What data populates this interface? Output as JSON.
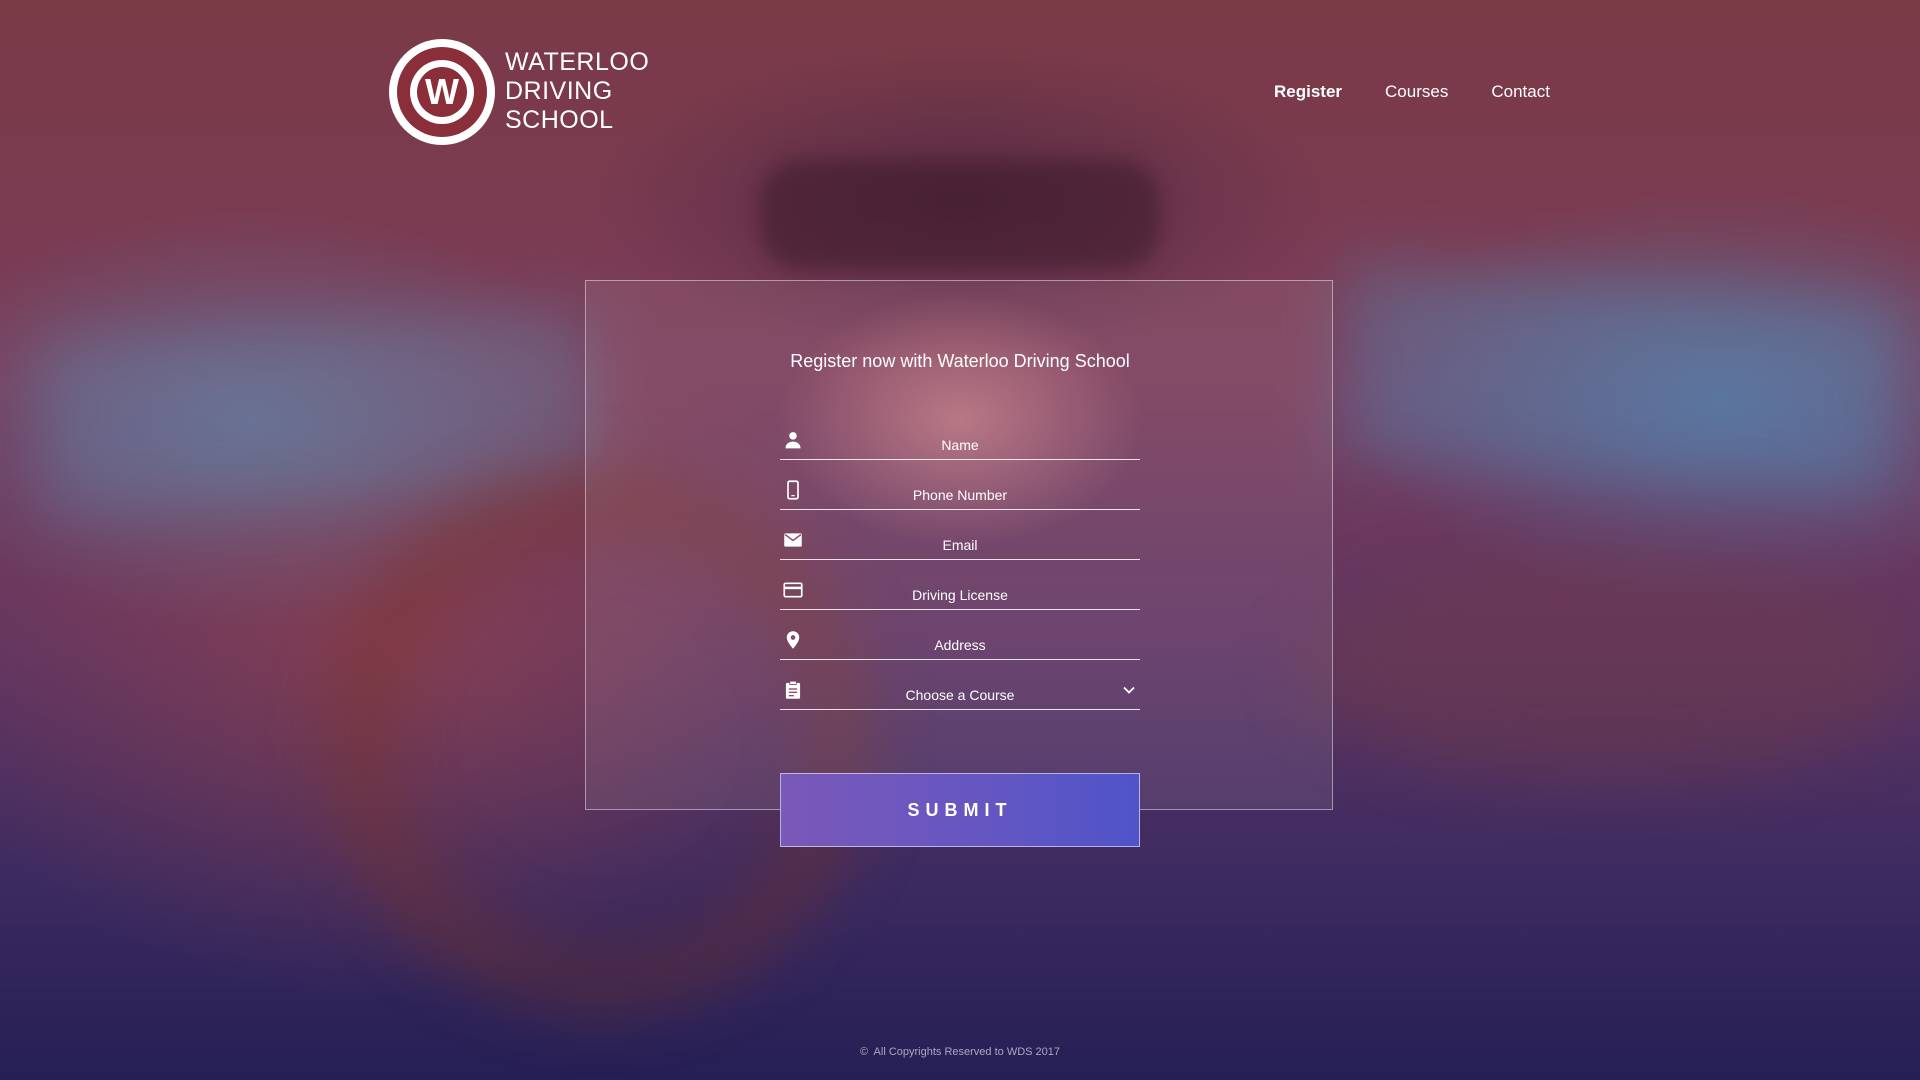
{
  "brand": {
    "logo_letter": "W",
    "name_lines": [
      "WATERLOO",
      "DRIVING",
      "SCHOOL"
    ]
  },
  "nav": {
    "items": [
      {
        "label": "Register",
        "active": true
      },
      {
        "label": "Courses",
        "active": false
      },
      {
        "label": "Contact",
        "active": false
      }
    ]
  },
  "form": {
    "title": "Register now with Waterloo Driving School",
    "fields": [
      {
        "icon": "person-icon",
        "placeholder": "Name"
      },
      {
        "icon": "phone-icon",
        "placeholder": "Phone Number"
      },
      {
        "icon": "mail-icon",
        "placeholder": "Email"
      },
      {
        "icon": "card-icon",
        "placeholder": "Driving License"
      },
      {
        "icon": "location-pin-icon",
        "placeholder": "Address"
      },
      {
        "icon": "clipboard-icon",
        "placeholder": "Choose a Course"
      }
    ],
    "submit_label": "SUBMIT"
  },
  "footer": {
    "copy_symbol": "©",
    "text": "All Copyrights Reserved to WDS 2017"
  },
  "colors": {
    "accent_start": "#7a59b8",
    "accent_end": "#4f54c8",
    "logo_red": "#8a2f3a"
  }
}
